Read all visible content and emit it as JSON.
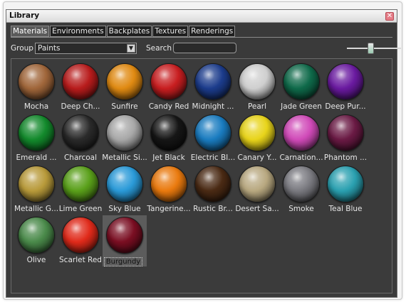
{
  "window": {
    "title": "Library",
    "close_glyph": "✕"
  },
  "tabs": [
    {
      "label": "Materials",
      "active": true
    },
    {
      "label": "Environments",
      "active": false
    },
    {
      "label": "Backplates",
      "active": false
    },
    {
      "label": "Textures",
      "active": false
    },
    {
      "label": "Renderings",
      "active": false
    }
  ],
  "toolbar": {
    "group_label": "Group",
    "group_value": "Paints",
    "search_label": "Search",
    "search_value": "",
    "dropdown_glyph": "▼",
    "thumbnail_size_fraction": 0.45
  },
  "materials": [
    {
      "label": "Mocha",
      "color": "#a0663a"
    },
    {
      "label": "Deep Ch...",
      "color": "#b81c1c"
    },
    {
      "label": "Sunfire",
      "color": "#e08a12"
    },
    {
      "label": "Candy Red",
      "color": "#c81e20"
    },
    {
      "label": "Midnight ...",
      "color": "#1c3c8c"
    },
    {
      "label": "Pearl",
      "color": "#cfcfcf"
    },
    {
      "label": "Jade Green",
      "color": "#0f6a4a"
    },
    {
      "label": "Deep Pur...",
      "color": "#6a1aa0"
    },
    {
      "label": "Emerald ...",
      "color": "#138a2c"
    },
    {
      "label": "Charcoal",
      "color": "#2a2a2a"
    },
    {
      "label": "Metallic Si...",
      "color": "#a8a8a8"
    },
    {
      "label": "Jet Black",
      "color": "#161616"
    },
    {
      "label": "Electric Bl...",
      "color": "#1a7cc0"
    },
    {
      "label": "Canary Y...",
      "color": "#e8d41a"
    },
    {
      "label": "Carnation...",
      "color": "#d04ab8"
    },
    {
      "label": "Phantom ...",
      "color": "#6a1a44"
    },
    {
      "label": "Metallic G...",
      "color": "#b89a3a"
    },
    {
      "label": "Lime Green",
      "color": "#5aa01a"
    },
    {
      "label": "Sky Blue",
      "color": "#2a9ad8"
    },
    {
      "label": "Tangerine...",
      "color": "#ea7a0e"
    },
    {
      "label": "Rustic Br...",
      "color": "#4a2a14"
    },
    {
      "label": "Desert Sa...",
      "color": "#b8a880"
    },
    {
      "label": "Smoke",
      "color": "#7a7a80"
    },
    {
      "label": "Teal Blue",
      "color": "#2aa0b0"
    },
    {
      "label": "Olive",
      "color": "#4a8a4a"
    },
    {
      "label": "Scarlet Red",
      "color": "#e02a1a"
    },
    {
      "label": "Burgundy",
      "color": "#7a0e22",
      "selected": true
    }
  ]
}
